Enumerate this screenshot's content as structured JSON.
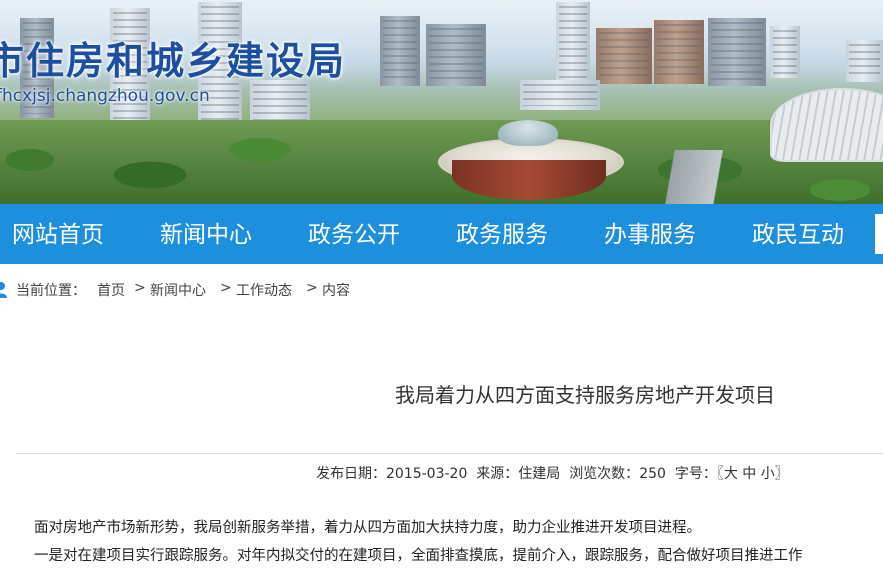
{
  "site": {
    "title": "市住房和城乡建设局",
    "url": "fhcxjsj.changzhou.gov.cn"
  },
  "colors": {
    "nav_background": "#1e8fdc",
    "title_blue": "#1d4fa0"
  },
  "nav": {
    "items": [
      {
        "label": "网站首页"
      },
      {
        "label": "新闻中心"
      },
      {
        "label": "政务公开"
      },
      {
        "label": "政务服务"
      },
      {
        "label": "办事服务"
      },
      {
        "label": "政民互动"
      }
    ]
  },
  "breadcrumb": {
    "icon": "location-pin-icon",
    "prefix": "当前位置：",
    "items": [
      "首页",
      "新闻中心",
      "工作动态",
      "内容"
    ],
    "separator": ">"
  },
  "article": {
    "title": "我局着力从四方面支持服务房地产开发项目",
    "meta": {
      "date_label": "发布日期：",
      "date": "2015-03-20",
      "source_label": "来源：",
      "source": "住建局",
      "views_label": "浏览次数：",
      "views": "250",
      "font_label": "字号：",
      "font_open": "〖",
      "font_large": "大",
      "font_medium": "中",
      "font_small": "小",
      "font_close": "〗"
    },
    "paragraphs": [
      "面对房地产市场新形势，我局创新服务举措，着力从四方面加大扶持力度，助力企业推进开发项目进程。",
      "一是对在建项目实行跟踪服务。对年内拟交付的在建项目，全面排查摸底，提前介入，跟踪服务，配合做好项目推进工作"
    ]
  }
}
